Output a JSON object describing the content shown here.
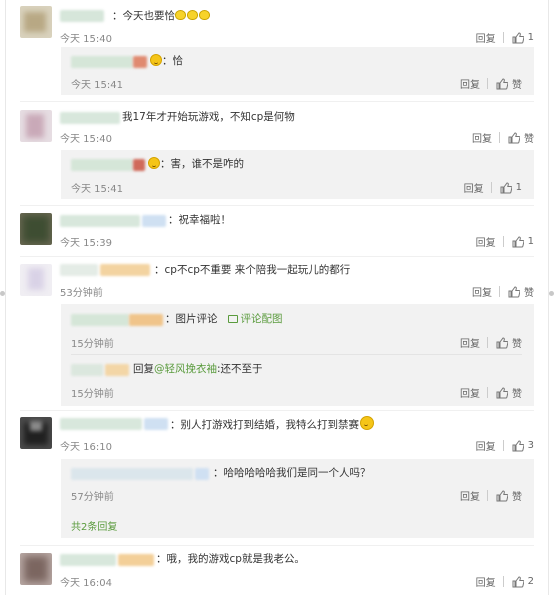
{
  "actions": {
    "reply_label": "回复",
    "like_label": "赞"
  },
  "comments": [
    {
      "text": "今天也要恰",
      "time": "今天 15:40",
      "likes": "1",
      "replies": [
        {
          "text": "恰",
          "time": "今天 15:41",
          "likes": "赞"
        }
      ]
    },
    {
      "text": "我17年才开始玩游戏，不知cp是何物",
      "time": "今天 15:40",
      "likes": "赞",
      "replies": [
        {
          "text": "害，谁不是咋的",
          "time": "今天 15:41",
          "likes": "1"
        }
      ]
    },
    {
      "text": "祝幸福啦！",
      "time": "今天 15:39",
      "likes": "1"
    },
    {
      "text": "cp不cp不重要 来个陪我一起玩儿的都行",
      "time": "53分钟前",
      "likes": "赞",
      "replies": [
        {
          "text": "图片评论",
          "link": "评论配图",
          "time": "15分钟前",
          "likes": "赞"
        },
        {
          "prefix": "回复",
          "mention": "@轻风挽衣袖",
          "text": ":还不至于",
          "time": "15分钟前",
          "likes": "赞"
        }
      ]
    },
    {
      "text": "别人打游戏打到结婚，我特么打到禁赛",
      "time": "今天 16:10",
      "likes": "3",
      "replies": [
        {
          "text": "哈哈哈哈哈我们是同一个人吗？",
          "time": "57分钟前",
          "likes": "赞"
        }
      ],
      "more": "共2条回复"
    },
    {
      "text": "哦，我的游戏cp就是我老公。",
      "time": "今天 16:04",
      "likes": "2"
    }
  ],
  "colors": {
    "link_green": "#5a9b3d",
    "meta_gray": "#888888",
    "reply_bg": "#f2f2f2"
  }
}
